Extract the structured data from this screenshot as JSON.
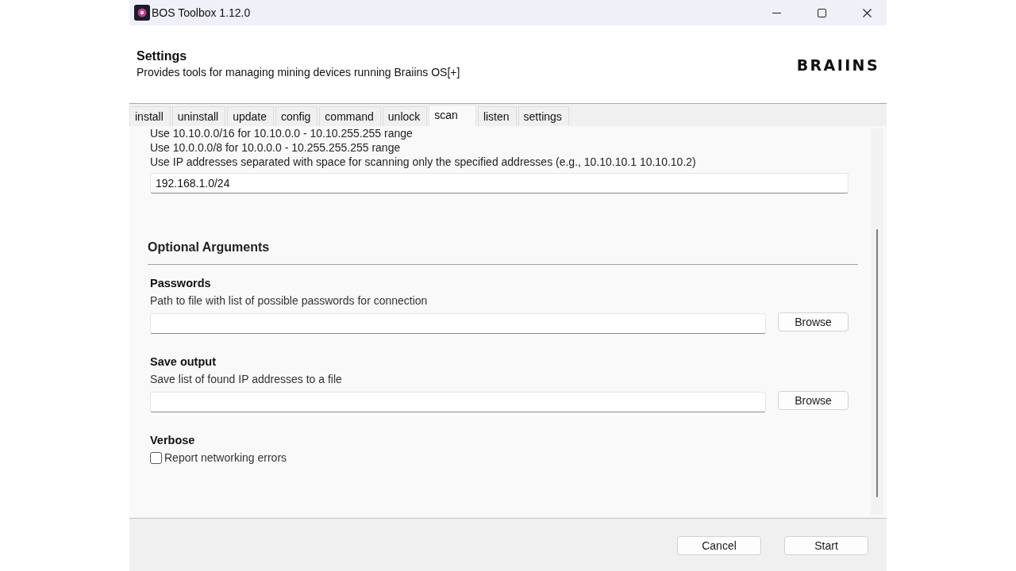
{
  "window": {
    "title": "BOS Toolbox 1.12.0"
  },
  "header": {
    "title": "Settings",
    "subtitle": "Provides tools for managing mining devices running Braiins OS[+]",
    "logo": "BRAIINS"
  },
  "tabs": [
    {
      "label": "install",
      "selected": false
    },
    {
      "label": "uninstall",
      "selected": false
    },
    {
      "label": "update",
      "selected": false
    },
    {
      "label": "config",
      "selected": false
    },
    {
      "label": "command",
      "selected": false
    },
    {
      "label": "unlock",
      "selected": false
    },
    {
      "label": "scan",
      "selected": true
    },
    {
      "label": "listen",
      "selected": false
    },
    {
      "label": "settings",
      "selected": false
    }
  ],
  "scan": {
    "help_lines": [
      "Use 10.10.0.0/16 for 10.10.0.0 - 10.10.255.255 range",
      "Use 10.0.0.0/8 for 10.0.0.0 - 10.255.255.255 range",
      "Use IP addresses separated with space for scanning only the specified addresses (e.g., 10.10.10.1 10.10.10.2)"
    ],
    "address_field": {
      "value": "192.168.1.0/24"
    },
    "optional_arguments": {
      "title": "Optional Arguments",
      "groups": [
        {
          "kind": "file",
          "title": "Passwords",
          "description": "Path to file with list of possible passwords for connection",
          "button": "Browse"
        },
        {
          "kind": "file",
          "title": "Save output",
          "description": "Save list of found IP addresses to a file",
          "button": "Browse"
        },
        {
          "kind": "checkbox",
          "title": "Verbose",
          "label": "Report networking errors",
          "checked": false
        }
      ]
    }
  },
  "buttons": [
    {
      "label": "Cancel"
    },
    {
      "label": "Start"
    }
  ]
}
